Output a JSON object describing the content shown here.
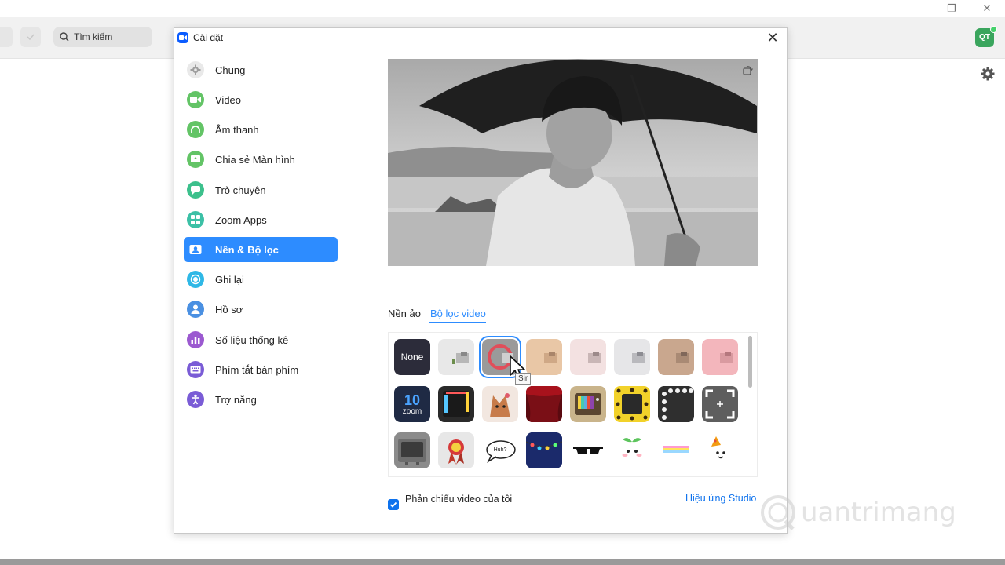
{
  "background": {
    "search_placeholder": "Tìm kiếm",
    "avatar_initials": "QT",
    "window_controls": [
      "–",
      "❐",
      "✕"
    ]
  },
  "dialog": {
    "title": "Cài đặt",
    "close_symbol": "✕"
  },
  "sidebar": {
    "items": [
      {
        "label": "Chung",
        "icon": "gear-icon",
        "color": "#9e9e9e"
      },
      {
        "label": "Video",
        "icon": "video-camera-icon",
        "color": "#63c466"
      },
      {
        "label": "Âm thanh",
        "icon": "headphones-icon",
        "color": "#63c466"
      },
      {
        "label": "Chia sẻ Màn hình",
        "icon": "share-screen-icon",
        "color": "#63c466"
      },
      {
        "label": "Trò chuyện",
        "icon": "chat-bubble-icon",
        "color": "#3cc08c"
      },
      {
        "label": "Zoom Apps",
        "icon": "apps-icon",
        "color": "#3cc0a6"
      },
      {
        "label": "Nền & Bộ lọc",
        "icon": "background-icon",
        "color": "#2d8cff",
        "active": true
      },
      {
        "label": "Ghi lại",
        "icon": "record-icon",
        "color": "#2fb8e6"
      },
      {
        "label": "Hồ sơ",
        "icon": "profile-icon",
        "color": "#4a90e2"
      },
      {
        "label": "Số liệu thống kê",
        "icon": "statistics-icon",
        "color": "#9b59d0"
      },
      {
        "label": "Phím tắt bàn phím",
        "icon": "keyboard-icon",
        "color": "#7a5cd6"
      },
      {
        "label": "Trợ năng",
        "icon": "accessibility-icon",
        "color": "#7a5cd6"
      }
    ]
  },
  "tabs": {
    "virtual_background": "Nền ảo",
    "video_filter": "Bộ lọc video",
    "active": "video_filter"
  },
  "filters": {
    "none_label": "None",
    "zoom_tile_number": "10",
    "zoom_tile_word": "zoom",
    "speech_bubble_text": "Huh?",
    "items": [
      {
        "name": "none",
        "bg": "#2c2c3a"
      },
      {
        "name": "tint-white",
        "bg": "#e8e8e8"
      },
      {
        "name": "tint-selected",
        "bg": "#9a9a9a",
        "selected": true
      },
      {
        "name": "tint-peach",
        "bg": "#e9c7a6"
      },
      {
        "name": "tint-pink",
        "bg": "#f3e1e1"
      },
      {
        "name": "tint-gray",
        "bg": "#e6e6e8"
      },
      {
        "name": "tint-tan",
        "bg": "#c9a78e"
      },
      {
        "name": "tint-rose",
        "bg": "#f3b6bc"
      },
      {
        "name": "zoom-10-frame",
        "bg": "#1f2a44"
      },
      {
        "name": "rainbow-tablet-frame",
        "bg": "#2a2a2a"
      },
      {
        "name": "corgi-ears",
        "bg": "#f2e7e0"
      },
      {
        "name": "theater-curtain",
        "bg": "#7a0f16"
      },
      {
        "name": "retro-tv",
        "bg": "#c9b48b"
      },
      {
        "name": "sunflower-frame",
        "bg": "#f2d22a"
      },
      {
        "name": "film-frame",
        "bg": "#2f2f2f"
      },
      {
        "name": "focus-frame",
        "bg": "#5e5e5e"
      },
      {
        "name": "old-tv",
        "bg": "#8b8b8b"
      },
      {
        "name": "award-ribbon",
        "bg": "#e7e7e7"
      },
      {
        "name": "speech-bubble",
        "bg": "#ffffff"
      },
      {
        "name": "string-lights",
        "bg": "#1b2a6b"
      },
      {
        "name": "sunglasses",
        "bg": "#ffffff"
      },
      {
        "name": "sprout-blush",
        "bg": "#ffffff"
      },
      {
        "name": "rainbow-bar",
        "bg": "#ffffff"
      },
      {
        "name": "party-hat",
        "bg": "#ffffff"
      }
    ]
  },
  "mirror": {
    "label": "Phản chiếu video của tôi",
    "checked": true
  },
  "studio_link": "Hiệu ứng Studio",
  "tooltip_text": "Sir",
  "watermark_text": "uantrimang",
  "colors": {
    "accent": "#2d8cff",
    "link": "#0e72ed"
  }
}
